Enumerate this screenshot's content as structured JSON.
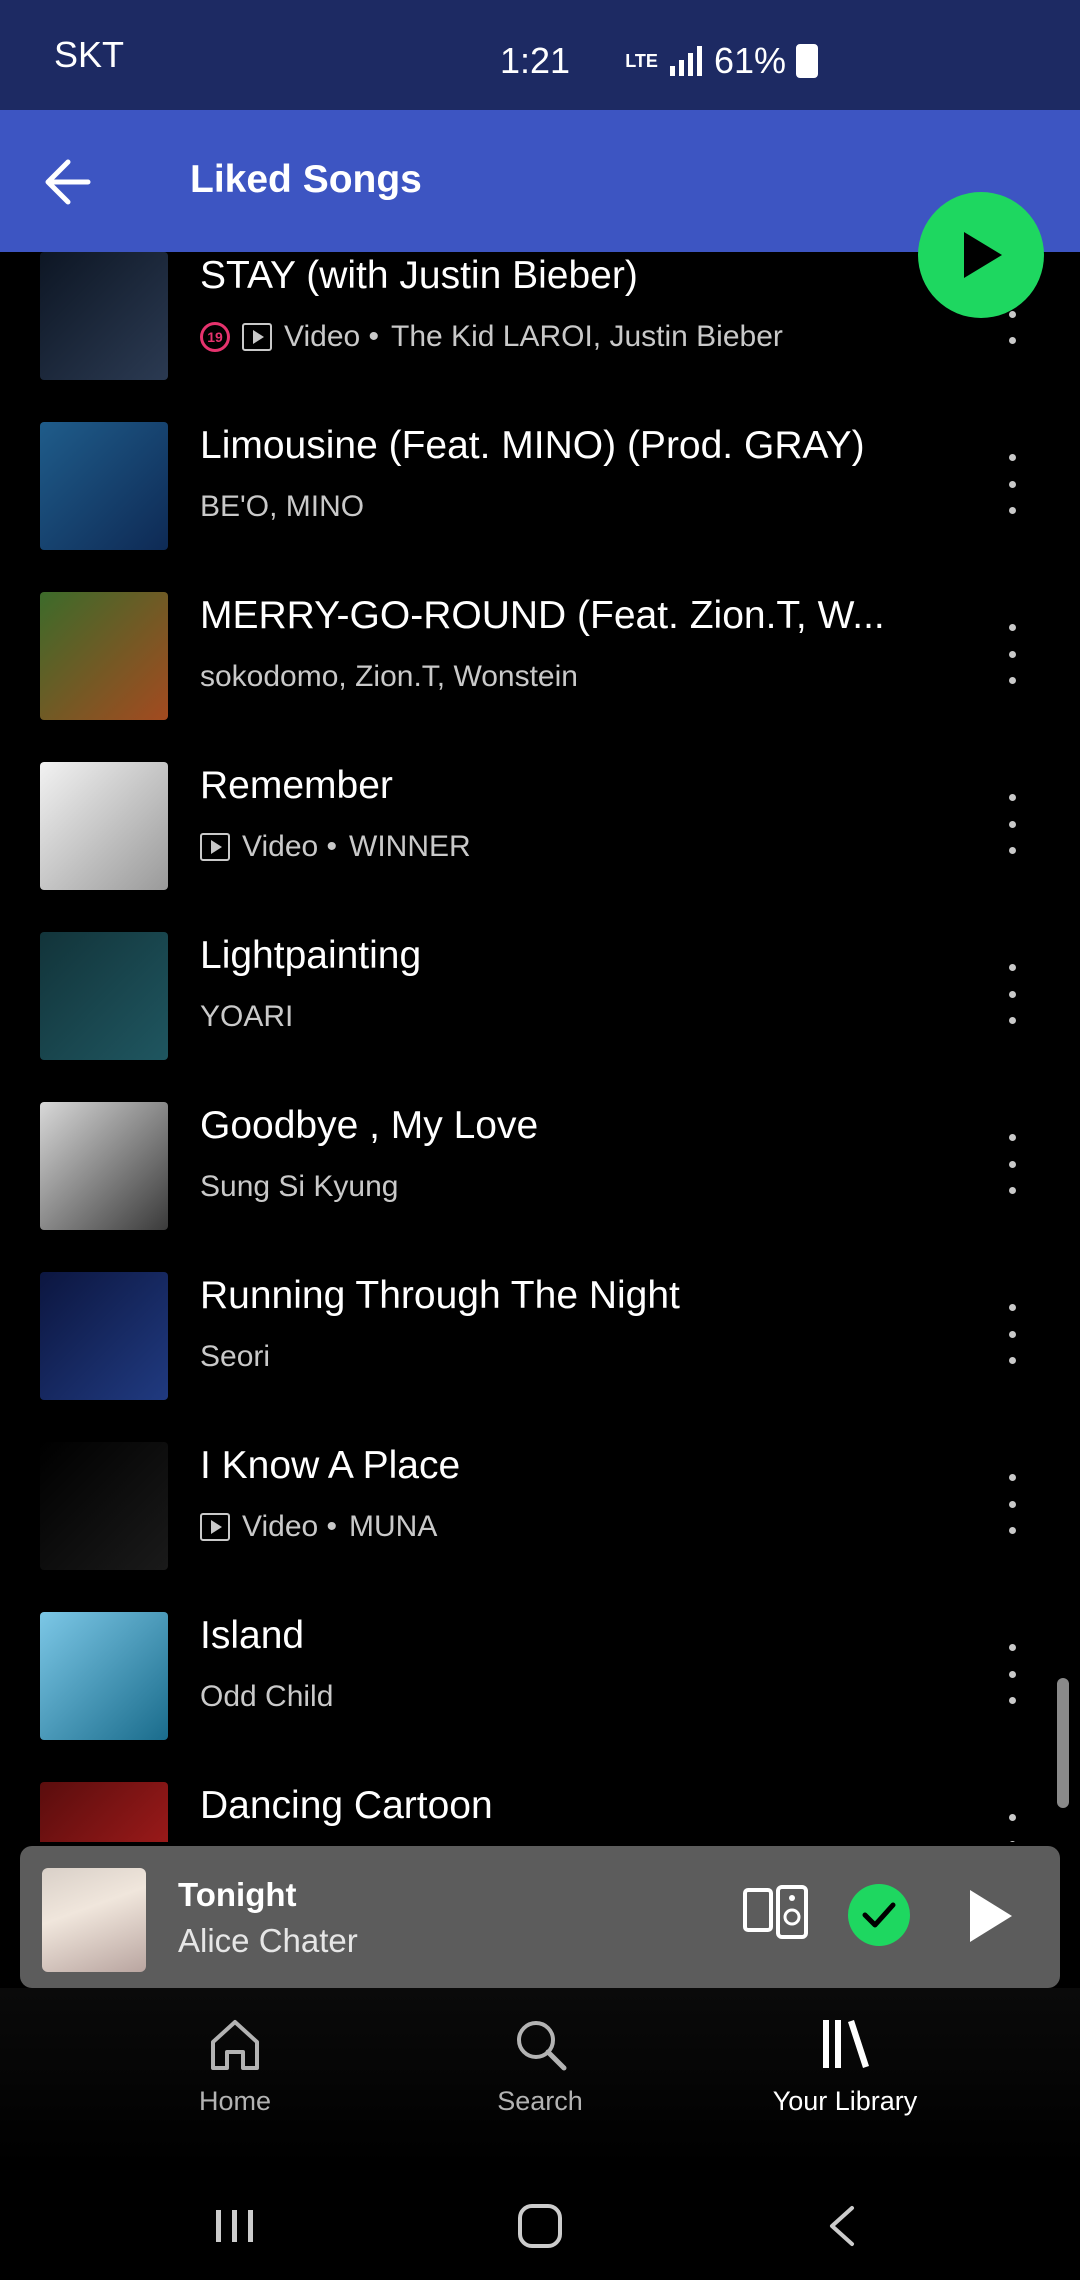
{
  "status_bar": {
    "carrier": "SKT",
    "time": "1:21",
    "network": "LTE",
    "battery": "61%"
  },
  "header": {
    "title": "Liked Songs"
  },
  "songs": [
    {
      "title": "STAY (with Justin Bieber)",
      "subtitle": "The Kid LAROI, Justin Bieber",
      "video": true,
      "explicit_badge": "19",
      "cover_colors": [
        "#0d1624",
        "#2b3a52"
      ]
    },
    {
      "title": "Limousine (Feat. MINO) (Prod. GRAY)",
      "subtitle": "BE'O, MINO",
      "video": false,
      "cover_colors": [
        "#1f5c8a",
        "#0e2a55"
      ]
    },
    {
      "title": "MERRY-GO-ROUND (Feat. Zion.T, W...",
      "subtitle": "sokodomo, Zion.T, Wonstein",
      "video": false,
      "cover_colors": [
        "#3c6b2a",
        "#a34a20"
      ]
    },
    {
      "title": "Remember",
      "subtitle": "WINNER",
      "video": true,
      "cover_colors": [
        "#f2f2f2",
        "#9a9a9a"
      ]
    },
    {
      "title": "Lightpainting",
      "subtitle": "YOARI",
      "video": false,
      "cover_colors": [
        "#12343a",
        "#1f5660"
      ]
    },
    {
      "title": "Goodbye , My Love",
      "subtitle": "Sung Si Kyung",
      "video": false,
      "cover_colors": [
        "#d8d8d8",
        "#3a3a3a"
      ]
    },
    {
      "title": "Running Through The Night",
      "subtitle": "Seori",
      "video": false,
      "cover_colors": [
        "#0c1640",
        "#203a80"
      ]
    },
    {
      "title": "I Know A Place",
      "subtitle": "MUNA",
      "video": true,
      "cover_colors": [
        "#000000",
        "#1a1a1a"
      ]
    },
    {
      "title": "Island",
      "subtitle": "Odd Child",
      "video": false,
      "cover_colors": [
        "#7cc7e6",
        "#1a6c8c"
      ]
    },
    {
      "title": "Dancing Cartoon",
      "subtitle": "",
      "video": false,
      "cover_colors": [
        "#5a0d0d",
        "#b01e1e"
      ]
    }
  ],
  "video_label": "Video •",
  "mini_player": {
    "title": "Tonight",
    "artist": "Alice Chater"
  },
  "nav": [
    {
      "label": "Home",
      "icon": "home-icon"
    },
    {
      "label": "Search",
      "icon": "search-icon"
    },
    {
      "label": "Your Library",
      "icon": "library-icon"
    }
  ],
  "colors": {
    "accent": "#1ed760",
    "header": "#3d55c2",
    "status": "#1d2a63"
  }
}
